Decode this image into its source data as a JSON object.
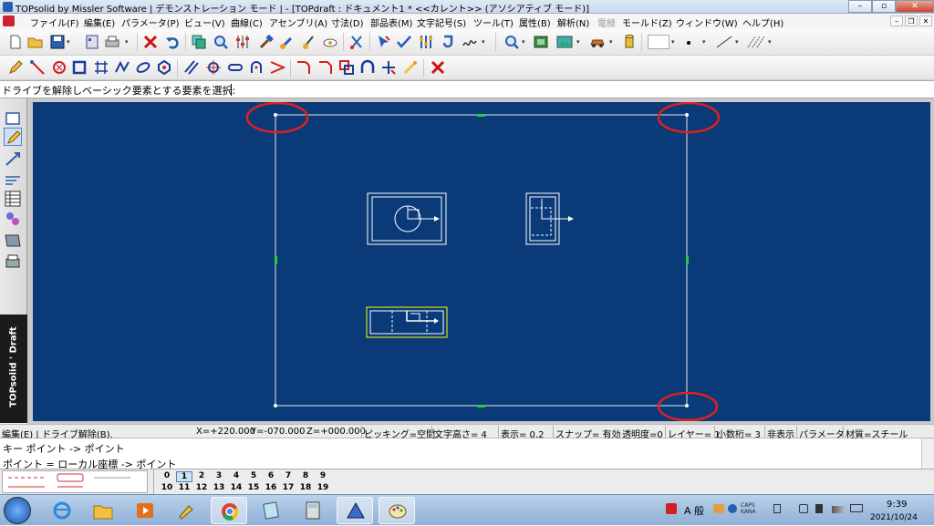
{
  "window": {
    "title": "TOPsolid by Missler Software | デモンストレーション モード | - [TOPdraft : ドキュメント1 *  <<カレント>> (アソシアティブ モード)]"
  },
  "menu": [
    {
      "label": "ファイル(F)",
      "disabled": false
    },
    {
      "label": "編集(E)",
      "disabled": false
    },
    {
      "label": "パラメータ(P)",
      "disabled": false
    },
    {
      "label": "ビュー(V)",
      "disabled": false
    },
    {
      "label": "曲線(C)",
      "disabled": false
    },
    {
      "label": "アセンブリ(A)",
      "disabled": false
    },
    {
      "label": "寸法(D)",
      "disabled": false
    },
    {
      "label": "部品表(M)",
      "disabled": false
    },
    {
      "label": "文字記号(S)",
      "disabled": false
    },
    {
      "label": "ツール(T)",
      "disabled": false
    },
    {
      "label": "属性(B)",
      "disabled": false
    },
    {
      "label": "解析(N)",
      "disabled": false
    },
    {
      "label": "電極",
      "disabled": true
    },
    {
      "label": "モールド(Z)",
      "disabled": false
    },
    {
      "label": "ウィンドウ(W)",
      "disabled": false
    },
    {
      "label": "ヘルプ(H)",
      "disabled": false
    }
  ],
  "prompt": {
    "text": "ドライブを解除しベーシック要素とする要素を選択:"
  },
  "brand": {
    "text": "TOPsolid ' Draft"
  },
  "status": {
    "mode": "編集(E) | ドライブ解除(B).",
    "x": "X=+220.000",
    "y": "Y=-070.000",
    "z": "Z=+000.000",
    "picking": "ピッキング=空間",
    "text_height": "文字高さ=  4",
    "display": "表示=   0.2",
    "snap": "スナップ= 有効",
    "transparency": "透明度=0",
    "layer": "レイヤー=  1",
    "decimals": "小数桁= 3",
    "hidden": "非表示",
    "parameter": "パラメータ",
    "material": "材質=スチール"
  },
  "messages": [
    "キー ポイント -> ポイント",
    "ポイント = ローカル座標 -> ポイント"
  ],
  "layers": {
    "row1": [
      "0",
      "1",
      "2",
      "3",
      "4",
      "5",
      "6",
      "7",
      "8",
      "9"
    ],
    "row2": [
      "10",
      "11",
      "12",
      "13",
      "14",
      "15",
      "16",
      "17",
      "18",
      "19"
    ],
    "current": "1"
  },
  "taskbar": {
    "tray_ime": "A 般",
    "time": "9:39",
    "date": "2021/10/24"
  },
  "colors": {
    "canvas_bg": "#0a3a78",
    "geometry": "#ffffff",
    "highlight": "#ffff00",
    "midpoint_marker": "#22cc44",
    "annotation_circle": "#e02020"
  }
}
